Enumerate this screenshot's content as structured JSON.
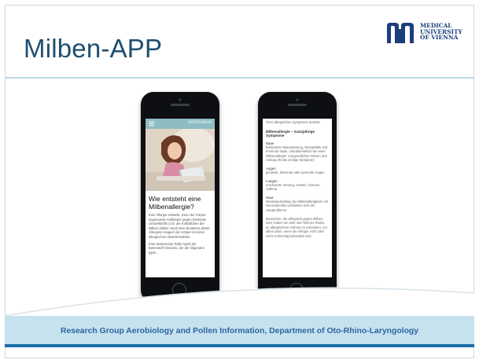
{
  "slide": {
    "title": "Milben-APP",
    "footer": "Research Group Aerobiology and Pollen Information, Department of Oto-Rhino-Laryngology"
  },
  "logo": {
    "text": "MEDICAL\nUNIVERSITY\nOF VIENNA"
  },
  "phone_left": {
    "app_bar_title": "Information",
    "heading": "Wie entsteht eine Milbenallergie?",
    "paragraph1": "Eine Allergie entsteht, wenn der Körper sogenannte Antikörper gegen harmlose Umweltstoffe (z.B. die Kotbällchen der Milben) bildet. Nach dem Einatmen dieser Allergene reagiert der Körper mit einer allergischen Abwehrreaktion.",
    "paragraph2": "Eine bedeutende Rolle spielt der Botenstoff Histamin, der die folgenden typis..."
  },
  "phone_right": {
    "top_text": "chen allergischen Symptome auslöst.",
    "heading": "Milbenallergie – Ganzjährige Symptome",
    "sections": [
      {
        "label": "Nase",
        "text": "behinderte Nasenatmung, Niesanfälle und rinnende Nase, charakteristisch bei einer Milbenallergie: morgendliches Niesen (am Anfang oft das einzige Symptom)"
      },
      {
        "label": "Augen",
        "text": "gerötete, tränende oder juckende Augen"
      },
      {
        "label": "Lungen",
        "text": "erschwerte Atmung, Husten, Giemen, Asthma"
      },
      {
        "label": "Haut",
        "text": "Nesselausschlag, bei Milbenallergikern mit Neurodermitis verstärken sich die Hautprobleme"
      }
    ],
    "closing": "Menschen, die allergisch gegen Milben sind, haben ein sehr viel höheres Risiko, an allergischem Asthma zu erkranken, vor allem dann, wenn die Allergie nicht oder nicht rechtzeitig behandelt wird."
  },
  "colors": {
    "title": "#1f4e6f",
    "app_bar": "#8dbcc2",
    "footer_band": "#c7e2ef",
    "footer_line": "#1b6da6",
    "footer_text": "#2b66a3",
    "logo": "#1b3f7a"
  }
}
